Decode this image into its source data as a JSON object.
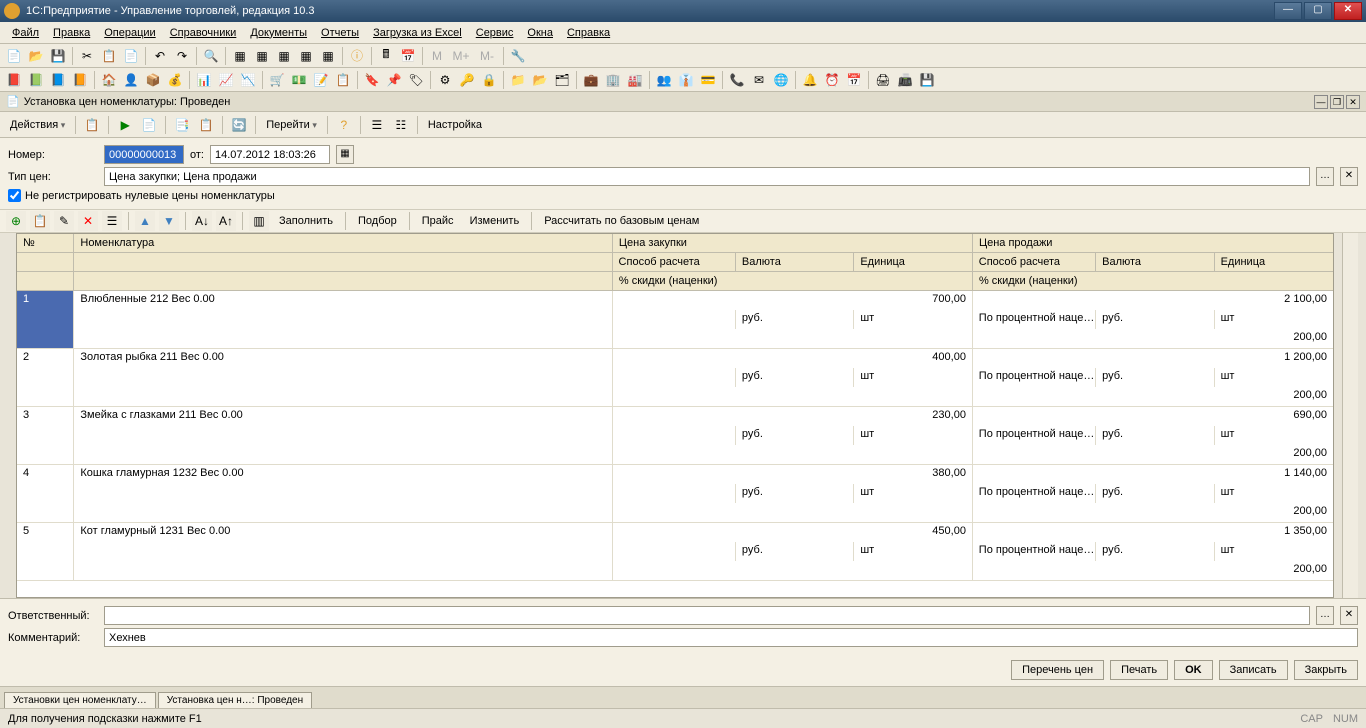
{
  "window": {
    "title": "1С:Предприятие - Управление торговлей, редакция 10.3"
  },
  "menu": [
    "Файл",
    "Правка",
    "Операции",
    "Справочники",
    "Документы",
    "Отчеты",
    "Загрузка из Excel",
    "Сервис",
    "Окна",
    "Справка"
  ],
  "doc_title": "Установка цен номенклатуры: Проведен",
  "doc_toolbar": {
    "actions": "Действия",
    "goto": "Перейти",
    "settings": "Настройка"
  },
  "form": {
    "number_label": "Номер:",
    "number": "00000000013",
    "ot": "от:",
    "date": "14.07.2012 18:03:26",
    "price_type_label": "Тип цен:",
    "price_type": "Цена закупки; Цена продажи",
    "checkbox": "Не регистрировать нулевые цены номенклатуры",
    "responsible_label": "Ответственный:",
    "responsible": "",
    "comment_label": "Комментарий:",
    "comment": "Хехнев"
  },
  "grid_toolbar": {
    "fill": "Заполнить",
    "select": "Подбор",
    "price": "Прайс",
    "change": "Изменить",
    "calc": "Рассчитать по базовым ценам"
  },
  "grid_headers": {
    "n": "№",
    "nom": "Номенклатура",
    "buy": "Цена закупки",
    "sell": "Цена продажи",
    "method": "Способ расчета",
    "currency": "Валюта",
    "unit": "Единица",
    "discount": "% скидки (наценки)"
  },
  "rows": [
    {
      "n": "1",
      "nom": "Влюбленные 212 Вес 0.00",
      "buy_price": "700,00",
      "buy_curr": "руб.",
      "buy_unit": "шт",
      "sell_price": "2 100,00",
      "sell_method": "По процентной наце…",
      "sell_curr": "руб.",
      "sell_unit": "шт",
      "sell_disc": "200,00",
      "selected": true
    },
    {
      "n": "2",
      "nom": "Золотая рыбка 211 Вес 0.00",
      "buy_price": "400,00",
      "buy_curr": "руб.",
      "buy_unit": "шт",
      "sell_price": "1 200,00",
      "sell_method": "По процентной наце…",
      "sell_curr": "руб.",
      "sell_unit": "шт",
      "sell_disc": "200,00"
    },
    {
      "n": "3",
      "nom": "Змейка с глазками 211 Вес 0.00",
      "buy_price": "230,00",
      "buy_curr": "руб.",
      "buy_unit": "шт",
      "sell_price": "690,00",
      "sell_method": "По процентной наце…",
      "sell_curr": "руб.",
      "sell_unit": "шт",
      "sell_disc": "200,00"
    },
    {
      "n": "4",
      "nom": "Кошка гламурная 1232 Вес 0.00",
      "buy_price": "380,00",
      "buy_curr": "руб.",
      "buy_unit": "шт",
      "sell_price": "1 140,00",
      "sell_method": "По процентной наце…",
      "sell_curr": "руб.",
      "sell_unit": "шт",
      "sell_disc": "200,00"
    },
    {
      "n": "5",
      "nom": "Кот гламурный 1231 Вес 0.00",
      "buy_price": "450,00",
      "buy_curr": "руб.",
      "buy_unit": "шт",
      "sell_price": "1 350,00",
      "sell_method": "По процентной наце…",
      "sell_curr": "руб.",
      "sell_unit": "шт",
      "sell_disc": "200,00"
    }
  ],
  "buttons": {
    "list": "Перечень цен",
    "print": "Печать",
    "ok": "OK",
    "save": "Записать",
    "close": "Закрыть"
  },
  "tabs": [
    "Установки цен номенклату…",
    "Установка цен н…: Проведен"
  ],
  "status": {
    "hint": "Для получения подсказки нажмите F1",
    "cap": "CAP",
    "num": "NUM"
  },
  "nav_labels": {
    "m": "M",
    "mplus": "M+",
    "mminus": "M-"
  }
}
